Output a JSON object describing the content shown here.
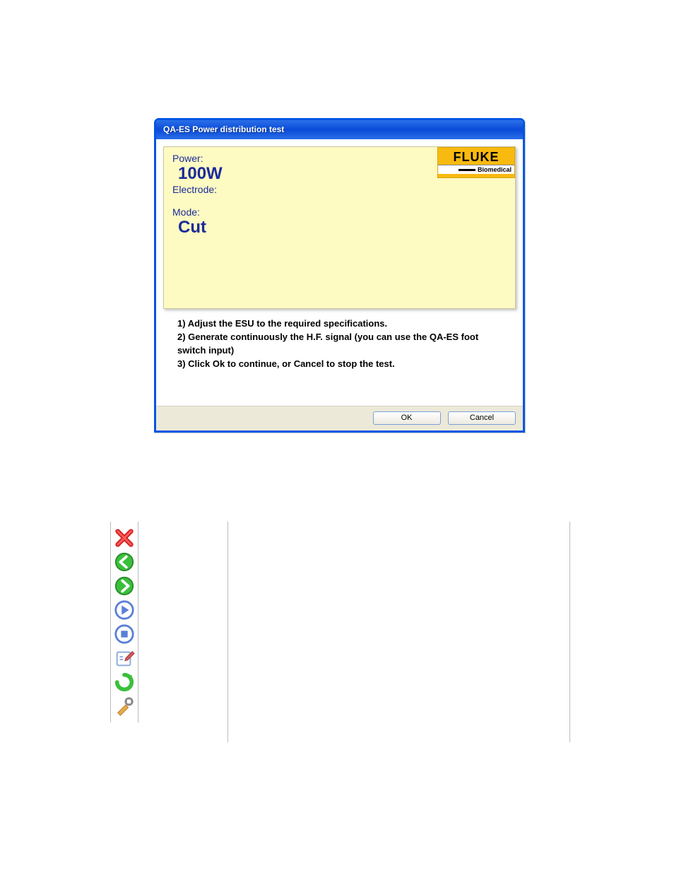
{
  "dialog": {
    "title": "QA-ES Power distribution test",
    "power_label": "Power:",
    "power_value": "100W",
    "electrode_label": "Electrode:",
    "mode_label": "Mode:",
    "mode_value": "Cut",
    "logo_brand": "FLUKE",
    "logo_sub": "Biomedical",
    "instructions": {
      "line1": "1) Adjust the ESU to the required specifications.",
      "line2": "2) Generate continuously the H.F. signal (you can use the QA-ES foot switch input)",
      "line3": "3) Click Ok to continue, or Cancel to stop the test."
    },
    "ok_label": "OK",
    "cancel_label": "Cancel"
  }
}
